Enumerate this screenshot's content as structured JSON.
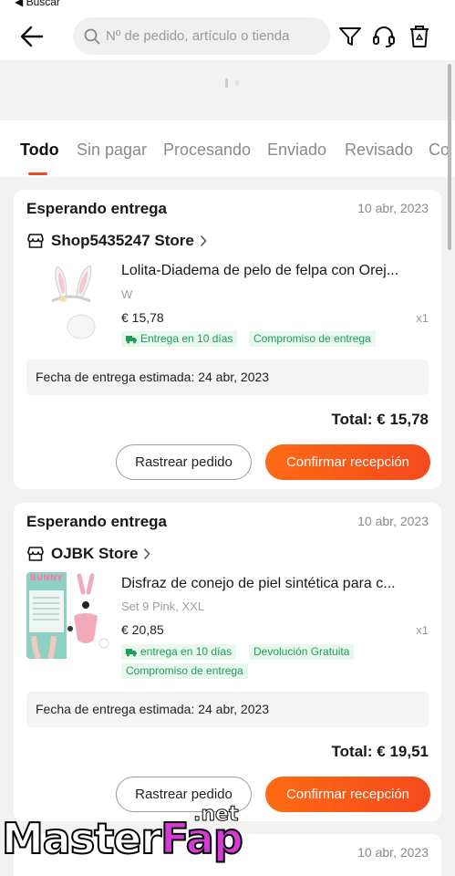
{
  "header": {
    "back_to_label": "◀ Buscar",
    "search_placeholder": "Nº de pedido, artículo o tienda"
  },
  "tabs": [
    {
      "label": "Todo",
      "active": true
    },
    {
      "label": "Sin pagar"
    },
    {
      "label": "Procesando"
    },
    {
      "label": "Enviado"
    },
    {
      "label": "Revisado"
    },
    {
      "label": "Co"
    }
  ],
  "orders": [
    {
      "status": "Esperando entrega",
      "date": "10 abr, 2023",
      "store": "Shop5435247 Store",
      "product_title": "Lolita-Diadema de pelo de felpa con Orej...",
      "variant": "W",
      "price": "€ 15,78",
      "qty": "x1",
      "tags": [
        "Entrega en 10 días",
        "Compromiso de entrega"
      ],
      "eta": "Fecha de entrega estimada: 24 abr, 2023",
      "total": "Total: € 15,78",
      "track_label": "Rastrear pedido",
      "confirm_label": "Confirmar recepción"
    },
    {
      "status": "Esperando entrega",
      "date": "10 abr, 2023",
      "store": "OJBK Store",
      "product_title": "Disfraz de conejo de piel sintética para c...",
      "variant": "Set 9 Pink, XXL",
      "price": "€ 20,85",
      "qty": "x1",
      "tags": [
        "entrega en 10 días",
        "Devolución Gratuita",
        "Compromiso de entrega"
      ],
      "thumb_text": "BUNNY",
      "eta": "Fecha de entrega estimada: 24 abr, 2023",
      "total": "Total: € 19,51",
      "track_label": "Rastrear pedido",
      "confirm_label": "Confirmar recepción"
    },
    {
      "date": "10 abr, 2023"
    }
  ],
  "watermark": {
    "master": "Master",
    "fap": "Fap",
    "net": ".net"
  },
  "colors": {
    "accent": "#f24822",
    "tag_bg": "#eaf7ee",
    "tag_text": "#1aa053"
  }
}
